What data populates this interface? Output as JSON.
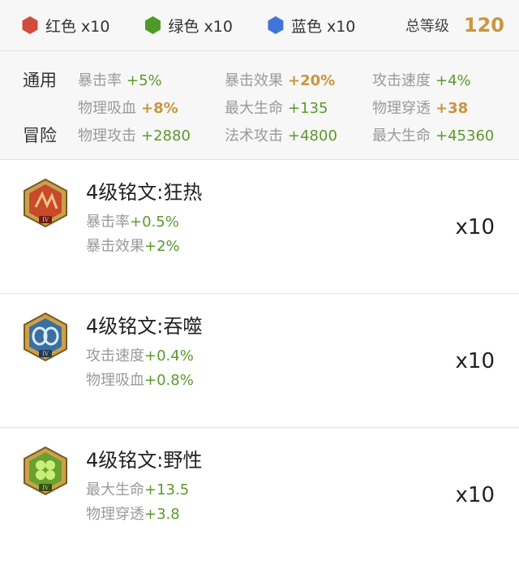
{
  "colors": {
    "red": "#d24b3c",
    "green": "#4e9a27",
    "blue": "#3f75d6",
    "stat_green": "#5b9a2b",
    "stat_gold": "#c8963e"
  },
  "summary": {
    "gems": [
      {
        "label": "红色 x10",
        "color": "#d24b3c"
      },
      {
        "label": "绿色 x10",
        "color": "#4e9a27"
      },
      {
        "label": "蓝色 x10",
        "color": "#3f75d6"
      }
    ],
    "total_label": "总等级",
    "total_value": "120"
  },
  "stats": {
    "general_label": "通用",
    "adventure_label": "冒险",
    "general": [
      {
        "name": "暴击率",
        "value": "+5%",
        "highlight": false
      },
      {
        "name": "暴击效果",
        "value": "+20%",
        "highlight": true
      },
      {
        "name": "攻击速度",
        "value": "+4%",
        "highlight": false
      },
      {
        "name": "物理吸血",
        "value": "+8%",
        "highlight": true
      },
      {
        "name": "最大生命",
        "value": "+135",
        "highlight": false
      },
      {
        "name": "物理穿透",
        "value": "+38",
        "highlight": true
      }
    ],
    "adventure": [
      {
        "name": "物理攻击",
        "value": "+2880"
      },
      {
        "name": "法术攻击",
        "value": "+4800"
      },
      {
        "name": "最大生命",
        "value": "+45360"
      }
    ]
  },
  "runes": [
    {
      "title": "4级铭文:狂热",
      "icon": "red-rune-icon",
      "count": "x10",
      "attrs": [
        {
          "name": "暴击率",
          "value": "+0.5%"
        },
        {
          "name": "暴击效果",
          "value": "+2%"
        }
      ]
    },
    {
      "title": "4级铭文:吞噬",
      "icon": "blue-rune-icon",
      "count": "x10",
      "attrs": [
        {
          "name": "攻击速度",
          "value": "+0.4%"
        },
        {
          "name": "物理吸血",
          "value": "+0.8%"
        }
      ]
    },
    {
      "title": "4级铭文:野性",
      "icon": "green-rune-icon",
      "count": "x10",
      "attrs": [
        {
          "name": "最大生命",
          "value": "+13.5"
        },
        {
          "name": "物理穿透",
          "value": "+3.8"
        }
      ]
    }
  ]
}
